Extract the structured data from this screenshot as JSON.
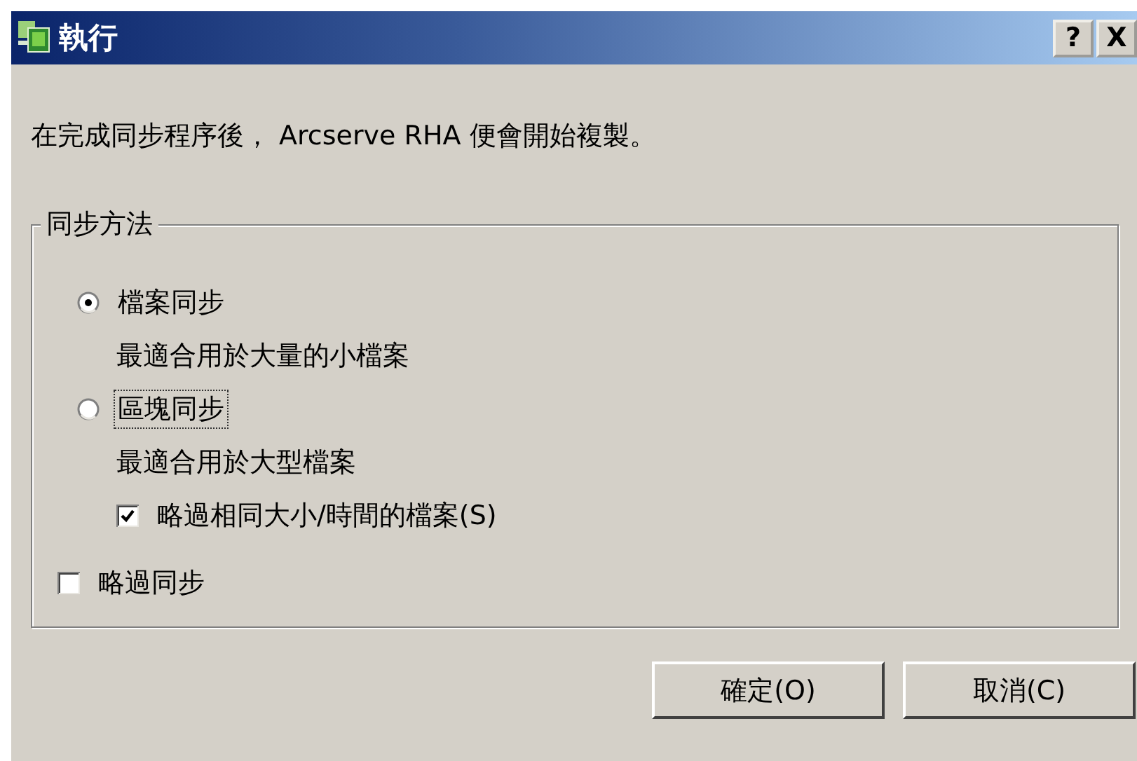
{
  "window": {
    "title": "執行",
    "help_button": "?",
    "close_button": "X"
  },
  "message": "在完成同步程序後， Arcserve RHA 便會開始複製。",
  "group": {
    "title": "同步方法",
    "options": [
      {
        "kind": "radio",
        "label": "檔案同步",
        "selected": true,
        "focused": false,
        "description": "最適合用於大量的小檔案"
      },
      {
        "kind": "radio",
        "label": "區塊同步",
        "selected": false,
        "focused": true,
        "description": "最適合用於大型檔案",
        "children": [
          {
            "kind": "checkbox",
            "label": "略過相同大小/時間的檔案(S)",
            "checked": true
          }
        ]
      },
      {
        "kind": "checkbox",
        "label": "略過同步",
        "checked": false
      }
    ]
  },
  "buttons": [
    {
      "label": "確定(O)"
    },
    {
      "label": "取消(C)"
    }
  ]
}
